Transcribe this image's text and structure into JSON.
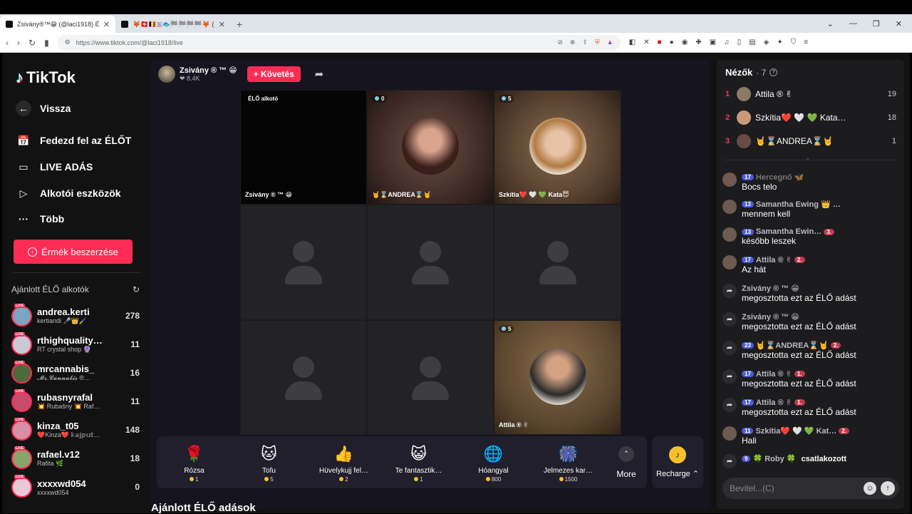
{
  "browser": {
    "tabs": [
      {
        "title": "Zsivány®™😁 (@laci1918) É…",
        "close": "✕"
      },
      {
        "title": "🦊🇨🇭🇧🇪🇸🐟🏁🏁🏁🏁🦊 (@csby0…",
        "close": "✕"
      }
    ],
    "new_tab": "+",
    "url": "https://www.tiktok.com/@laci1918/live"
  },
  "sidebar": {
    "logo": "TikTok",
    "back": "Vissza",
    "nav": [
      "Fedezd fel az ÉLŐT",
      "LIVE ADÁS",
      "Alkotói eszközök",
      "Több"
    ],
    "coin_button": "Érmék beszerzése",
    "recommended_title": "Ajánlott ÉLŐ alkotók",
    "live_badge": "LIVE",
    "creators": [
      {
        "name": "andrea.kerti",
        "sub": "kertiandi 🎤👑🖌️",
        "count": "278"
      },
      {
        "name": "rthighquality…",
        "sub": "RT crystal shop 🔮",
        "count": "11"
      },
      {
        "name": "mrcannabis_",
        "sub": "𝓜𝓻.𝓒𝓪𝓷𝓷𝓪𝓫𝓲𝓼 ®…",
        "count": "16"
      },
      {
        "name": "rubasnyrafal",
        "sub": "💥 Rubašny 💥 Raf…",
        "count": "11"
      },
      {
        "name": "kinza_t05",
        "sub": "❤️Kinza❤️ 𝕜𝕒𝕛𝕡𝕦𝕥…",
        "count": "148"
      },
      {
        "name": "rafael.v12",
        "sub": "Rafita 🌿",
        "count": "18"
      },
      {
        "name": "xxxxwd054",
        "sub": "xxxxwd054",
        "count": "0"
      }
    ]
  },
  "stage": {
    "host_name": "Zsivány ® ™ 😁",
    "host_likes": "❤ 8.4K",
    "follow_label": "+ Követés",
    "cells": [
      {
        "tag": "ÉLŐ alkotó",
        "name": "Zsivány ® ™ 😁",
        "count": ""
      },
      {
        "tag": "",
        "name": "🤘⌛ANDREA⌛🤘",
        "count": "0"
      },
      {
        "tag": "",
        "name": "Szkítia❤️ 🤍 💚 Kata😇",
        "count": "5"
      },
      {
        "tag": "",
        "name": "",
        "count": ""
      },
      {
        "tag": "",
        "name": "",
        "count": ""
      },
      {
        "tag": "",
        "name": "",
        "count": ""
      },
      {
        "tag": "",
        "name": "",
        "count": ""
      },
      {
        "tag": "",
        "name": "",
        "count": ""
      },
      {
        "tag": "",
        "name": "Attila ® ✌",
        "count": "5"
      }
    ],
    "gifts": [
      {
        "icon": "🌹",
        "name": "Rózsa",
        "price": "1"
      },
      {
        "icon": "🐱",
        "name": "Tofu",
        "price": "5"
      },
      {
        "icon": "👍",
        "name": "Hüvelykujj fel…",
        "price": "2"
      },
      {
        "icon": "😺",
        "name": "Te fantasztik…",
        "price": "1"
      },
      {
        "icon": "🌐",
        "name": "Hóangyal",
        "price": "800"
      },
      {
        "icon": "🎆",
        "name": "Jelmezes kar…",
        "price": "1500"
      }
    ],
    "more_label": "More",
    "recharge_label": "Recharge ⌃",
    "footer_title": "Ajánlott ÉLŐ adások"
  },
  "chat": {
    "viewers_label": "Nézők",
    "viewers_count": "· 7",
    "ranking": [
      {
        "rank": "1",
        "name": "Attila ® ✌",
        "score": "19"
      },
      {
        "rank": "2",
        "name": "Szkítia❤️ 🤍 💚 Kata…",
        "score": "18"
      },
      {
        "rank": "3",
        "name": "🤘⌛ANDREA⌛🤘",
        "score": "1"
      }
    ],
    "messages": [
      {
        "badge": "17",
        "user": "Hercegnő 🦋",
        "text": "Bocs telo",
        "dim": true,
        "share": false
      },
      {
        "badge": "13",
        "user": "Samantha Ewing 👑 …",
        "text": "mennem kell",
        "dim": false,
        "share": false
      },
      {
        "badge": "13",
        "user": "Samantha Ewin…",
        "text": "később leszek",
        "dim": false,
        "share": false,
        "badge2": "3."
      },
      {
        "badge": "17",
        "user": "Attila ® ✌",
        "text": "Az hát",
        "dim": false,
        "share": false,
        "badge2": "2."
      },
      {
        "badge": "",
        "user": "Zsivány ® ™ 😁",
        "text": "megosztotta ezt az ÉLŐ adást",
        "dim": false,
        "share": true
      },
      {
        "badge": "",
        "user": "Zsivány ® ™ 😁",
        "text": "megosztotta ezt az ÉLŐ adást",
        "dim": false,
        "share": true
      },
      {
        "badge": "23",
        "user": "🤘⌛ANDREA⌛🤘",
        "text": "megosztotta ezt az ÉLŐ adást",
        "dim": false,
        "share": true,
        "badge2": "2."
      },
      {
        "badge": "17",
        "user": "Attila ® ✌",
        "text": "megosztotta ezt az ÉLŐ adást",
        "dim": false,
        "share": true,
        "badge2": "1."
      },
      {
        "badge": "17",
        "user": "Attila ® ✌",
        "text": "megosztotta ezt az ÉLŐ adást",
        "dim": false,
        "share": true,
        "badge2": "1."
      },
      {
        "badge": "11",
        "user": "Szkítia❤️ 🤍 💚 Kat…",
        "text": "Hali",
        "dim": false,
        "share": false,
        "badge2": "2."
      },
      {
        "badge": "9",
        "user": "🍀 Roby 🍀",
        "text": "csatlakozott",
        "dim": false,
        "share": true,
        "inline": true
      }
    ],
    "input_placeholder": "Bevitel...(C)"
  }
}
